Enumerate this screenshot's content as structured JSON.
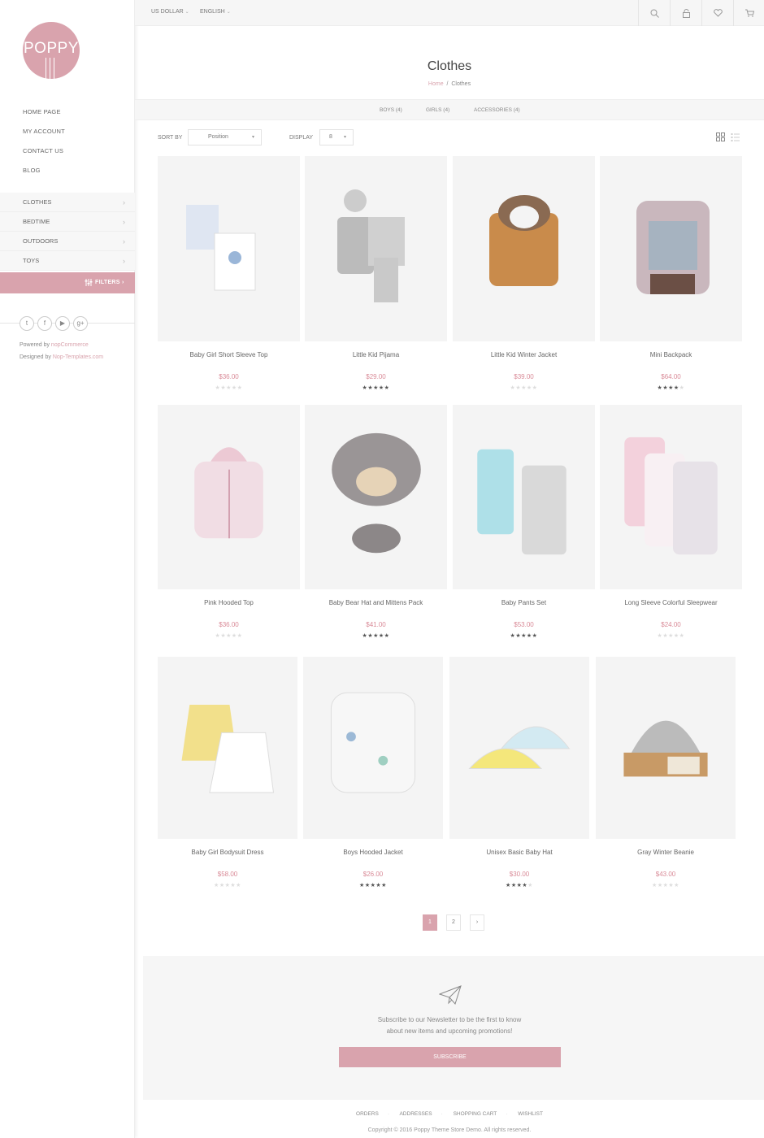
{
  "brand": {
    "logo_text": "POPPY"
  },
  "sidebar": {
    "links": [
      "HOME PAGE",
      "MY ACCOUNT",
      "CONTACT US",
      "BLOG"
    ],
    "categories": [
      "CLOTHES",
      "BEDTIME",
      "OUTDOORS",
      "TOYS"
    ],
    "filters_label": "FILTERS",
    "powered_by": "Powered by",
    "powered_link": "nopCommerce",
    "designed_by": "Designed by",
    "designed_link": "Nop-Templates.com"
  },
  "topbar": {
    "currency": "US DOLLAR",
    "language": "ENGLISH"
  },
  "page": {
    "title": "Clothes",
    "breadcrumb_home": "Home",
    "breadcrumb_sep": "/",
    "breadcrumb_current": "Clothes",
    "subcategories": [
      "BOYS (4)",
      "GIRLS (4)",
      "ACCESSORIES (4)"
    ]
  },
  "toolbar": {
    "sort_label": "SORT BY",
    "sort_value": "Position",
    "display_label": "DISPLAY",
    "display_value": "8"
  },
  "products": [
    {
      "name": "Baby Girl Short Sleeve Top",
      "price": "$36.00",
      "rating": 0
    },
    {
      "name": "Little Kid Pijama",
      "price": "$29.00",
      "rating": 5
    },
    {
      "name": "Little Kid Winter Jacket",
      "price": "$39.00",
      "rating": 0
    },
    {
      "name": "Mini Backpack",
      "price": "$64.00",
      "rating": 4
    },
    {
      "name": "Pink Hooded Top",
      "price": "$36.00",
      "rating": 0
    },
    {
      "name": "Baby Bear Hat and Mittens Pack",
      "price": "$41.00",
      "rating": 5
    },
    {
      "name": "Baby Pants Set",
      "price": "$53.00",
      "rating": 5
    },
    {
      "name": "Long Sleeve Colorful Sleepwear",
      "price": "$24.00",
      "rating": 0
    },
    {
      "name": "Baby Girl Bodysuit Dress",
      "price": "$58.00",
      "rating": 0
    },
    {
      "name": "Boys Hooded Jacket",
      "price": "$26.00",
      "rating": 5
    },
    {
      "name": "Unisex Basic Baby Hat",
      "price": "$30.00",
      "rating": 4
    },
    {
      "name": "Gray Winter Beanie",
      "price": "$43.00",
      "rating": 0
    }
  ],
  "pager": {
    "page1": "1",
    "page2": "2",
    "next": "›"
  },
  "newsletter": {
    "line1": "Subscribe to our Newsletter to be the first to know",
    "line2": "about new items and upcoming promotions!",
    "button": "SUBSCRIBE"
  },
  "footer": {
    "links": [
      "ORDERS",
      "ADDRESSES",
      "SHOPPING CART",
      "WISHLIST"
    ],
    "copyright": "Copyright © 2016 Poppy Theme Store Demo. All rights reserved."
  },
  "colors": {
    "accent": "#d9a3ad",
    "price": "#d98a97"
  },
  "icons": [
    "search-icon",
    "lock-icon",
    "heart-icon",
    "cart-icon",
    "grid-view-icon",
    "list-view-icon",
    "paper-plane-icon",
    "twitter-icon",
    "facebook-icon",
    "youtube-icon",
    "google-plus-icon",
    "filter-icon"
  ]
}
